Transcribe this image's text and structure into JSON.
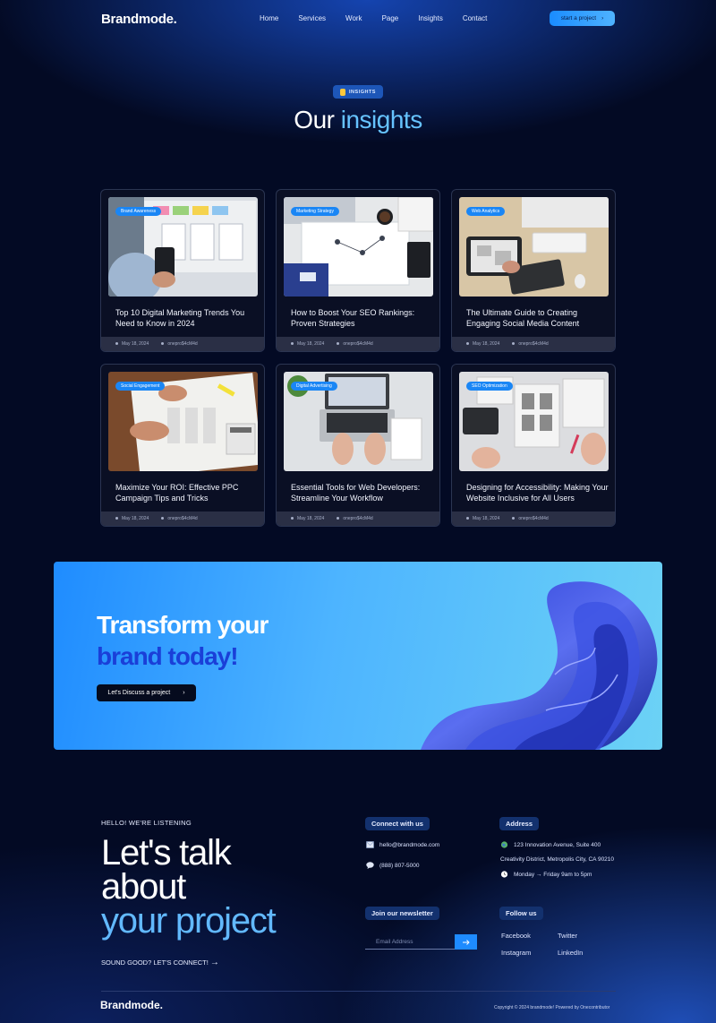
{
  "nav": {
    "logo": "Brandmode.",
    "links": [
      "Home",
      "Services",
      "Work",
      "Page",
      "Insights",
      "Contact"
    ],
    "cta": "start a project"
  },
  "insights": {
    "badge": "INSIGHTS",
    "title_a": "Our",
    "title_b": "insights",
    "cards": [
      {
        "tag": "Brand Awareness",
        "title": "Top 10 Digital Marketing Trends You Need to Know in 2024",
        "date": "May 18, 2024",
        "author": "onepro$4cM4d"
      },
      {
        "tag": "Marketing Strategy",
        "title": "How to Boost Your SEO Rankings: Proven Strategies",
        "date": "May 18, 2024",
        "author": "onepro$4cM4d"
      },
      {
        "tag": "Web Analytics",
        "title": "The Ultimate Guide to Creating Engaging Social Media Content",
        "date": "May 18, 2024",
        "author": "onepro$4cM4d"
      },
      {
        "tag": "Social Engagement",
        "title": "Maximize Your ROI: Effective PPC Campaign Tips and Tricks",
        "date": "May 18, 2024",
        "author": "onepro$4cM4d"
      },
      {
        "tag": "Digital Advertising",
        "title": "Essential Tools for Web Developers: Streamline Your Workflow",
        "date": "May 18, 2024",
        "author": "onepro$4cM4d"
      },
      {
        "tag": "SEO Optimization",
        "title": "Designing for Accessibility: Making Your Website Inclusive for All Users",
        "date": "May 18, 2024",
        "author": "onepro$4cM4d"
      }
    ]
  },
  "banner": {
    "line1": "Transform your",
    "line2": "brand today!",
    "button": "Let's Discuss a project"
  },
  "contact": {
    "eyebrow": "HELLO! WE'RE LISTENING",
    "big1": "Let's talk",
    "big2": "about",
    "big3": "your project",
    "sound": "SOUND GOOD? LET'S CONNECT!",
    "connect_label": "Connect with us",
    "email": "hello@brandmode.com",
    "phone": "(888) 807-5000",
    "address_label": "Address",
    "address1": "123 Innovation Avenue, Suite 400",
    "address2": "Creativity District, Metropolis City, CA 90210",
    "hours": "Monday → Friday 9am to 5pm",
    "newsletter_label": "Join our newsletter",
    "email_placeholder": "Email Address",
    "follow_label": "Follow us",
    "socials": [
      "Facebook",
      "Twitter",
      "Instagram",
      "LinkedIn"
    ]
  },
  "footer": {
    "logo": "Brandmode.",
    "copyright": "Copyright © 2024 brandmode! Powered by Onecontributor"
  },
  "colors": {
    "accent": "#1a8cff",
    "highlight": "#62b9ff",
    "background": "#030a24"
  }
}
